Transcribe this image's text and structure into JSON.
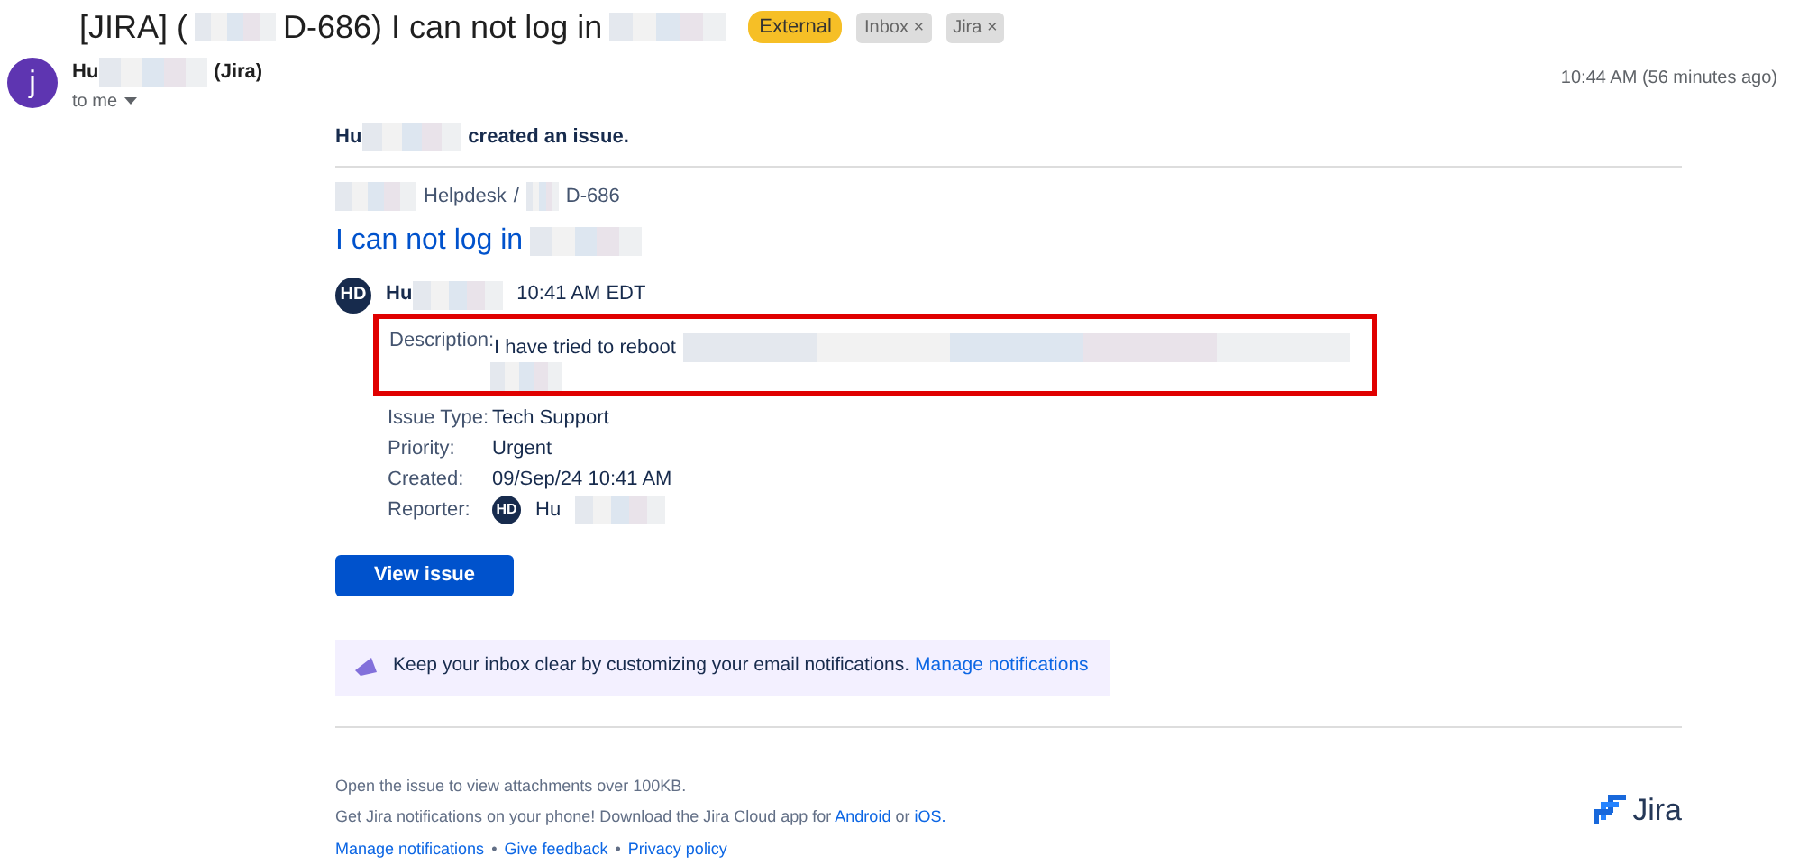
{
  "subject": {
    "parts": [
      {
        "text": "[JIRA] (",
        "redacted_after": true
      },
      {
        "text": "D-686) I can not log in",
        "redacted_after": true
      }
    ],
    "labels": [
      {
        "text": "External",
        "kind": "external"
      },
      {
        "text": "Inbox",
        "kind": "removable",
        "close": "×"
      },
      {
        "text": "Jira",
        "kind": "removable",
        "close": "×"
      }
    ]
  },
  "sender": {
    "avatar": "j",
    "name_start": "Hu",
    "name_end": "(Jira)",
    "recipient": "to me",
    "time": "10:44 AM (56 minutes ago)"
  },
  "email": {
    "intro": {
      "name_start": "Hu",
      "action": "created an issue."
    },
    "breadcrumb": {
      "project": "Helpdesk",
      "separator": "/",
      "key": "D-686"
    },
    "issue_title": "I can not log in",
    "comment": {
      "avatar": "HD",
      "name_start": "Hu",
      "time": "10:41 AM EDT"
    },
    "description": {
      "label": "Description:",
      "text": "I have tried to reboot",
      "highlighted": true
    },
    "fields": [
      {
        "label": "Issue Type:",
        "value": "Tech Support",
        "kind": "text"
      },
      {
        "label": "Priority:",
        "value": "Urgent",
        "kind": "text"
      },
      {
        "label": "Created:",
        "value": "09/Sep/24 10:41 AM",
        "kind": "text"
      },
      {
        "label": "Reporter:",
        "value": "Hu",
        "avatar": "HD",
        "kind": "user"
      }
    ],
    "button": "View issue",
    "banner": {
      "text": "Keep your inbox clear by customizing your email notifications.",
      "link": "Manage notifications"
    },
    "footer": {
      "line1": "Open the issue to view attachments over 100KB.",
      "line2": "Get Jira notifications on your phone! Download the Jira Cloud app for",
      "android": "Android",
      "or": "or",
      "ios": "iOS.",
      "links": [
        "Manage notifications",
        "Give feedback",
        "Privacy policy"
      ],
      "sep": "•",
      "logo": "Jira"
    }
  }
}
